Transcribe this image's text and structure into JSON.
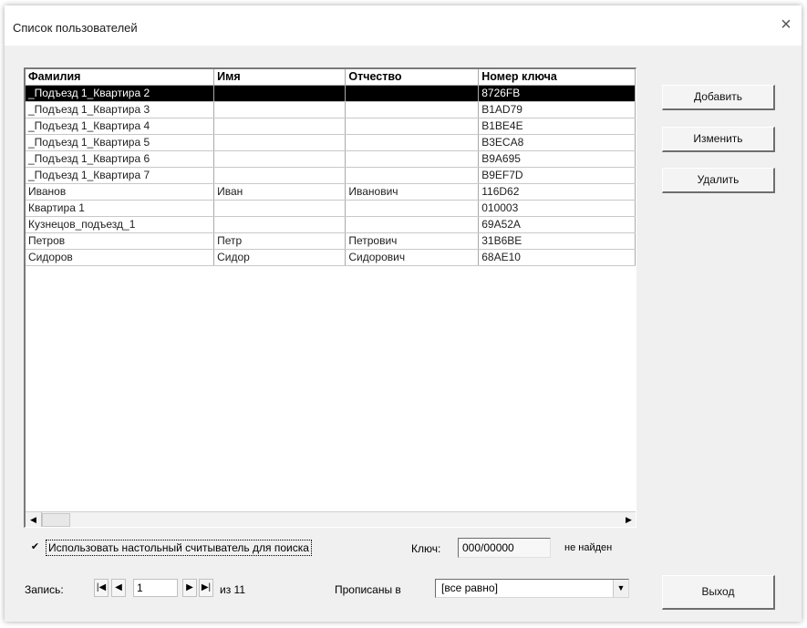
{
  "window": {
    "title": "Список пользователей",
    "close_icon": "×"
  },
  "table": {
    "columns": [
      "Фамилия",
      "Имя",
      "Отчество",
      "Номер ключа"
    ],
    "selected_row": 0,
    "rows": [
      [
        "_Подъезд 1_Квартира 2",
        "",
        "",
        "8726FB"
      ],
      [
        "_Подъезд 1_Квартира 3",
        "",
        "",
        "B1AD79"
      ],
      [
        "_Подъезд 1_Квартира 4",
        "",
        "",
        "B1BE4E"
      ],
      [
        "_Подъезд 1_Квартира 5",
        "",
        "",
        "B3ECA8"
      ],
      [
        "_Подъезд 1_Квартира 6",
        "",
        "",
        "B9A695"
      ],
      [
        "_Подъезд 1_Квартира 7",
        "",
        "",
        "B9EF7D"
      ],
      [
        "Иванов",
        "Иван",
        "Иванович",
        "116D62"
      ],
      [
        "Квартира 1",
        "",
        "",
        "010003"
      ],
      [
        "Кузнецов_подъезд_1",
        "",
        "",
        "69A52A"
      ],
      [
        "Петров",
        "Петр",
        "Петрович",
        "31B6BE"
      ],
      [
        "Сидоров",
        "Сидор",
        "Сидорович",
        "68AE10"
      ]
    ]
  },
  "buttons": {
    "add": "Добавить",
    "edit": "Изменить",
    "delete": "Удалить",
    "exit": "Выход"
  },
  "search": {
    "checkbox_checked": true,
    "checkbox_label": "Использовать настольный считыватель для поиска",
    "key_label": "Ключ:",
    "key_value": "000/00000",
    "key_status": "не найден"
  },
  "navigation": {
    "record_label": "Запись:",
    "record_value": "1",
    "total_label": "из 11"
  },
  "filter": {
    "label": "Прописаны в",
    "selected": "[все равно]"
  }
}
